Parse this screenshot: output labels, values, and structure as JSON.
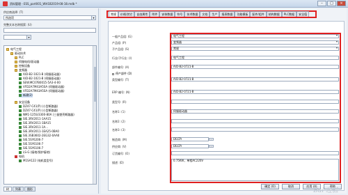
{
  "window": {
    "title": "资料管理 - ESS_part001_WH1B2019-08-18.mdb *"
  },
  "left": {
    "type_label": "供应商选择: (T)",
    "type_value": "所选项",
    "search_label": "完整文本名称搜索: (U)",
    "tree": [
      "电气工程",
      "驱动技术",
      "PLC",
      "伺服电机/驱动器",
      "控制设备",
      "变频器",
      "A/D-B2-1021-B (伺服驱动器)",
      "A/D-B2-1021-B (伺服驱动器)",
      "SEW.MC07B0015-5A3-4-00",
      "VFD2A7M43A5SA (伺服驱动器)",
      "VFD2A7M43A5SA (伺服驱动器)",
      "新建(2)",
      "安全设备",
      "DZ47-C41(P) (小型断路器)",
      "DZ47-C41(P) (小型断路器)",
      "NM1-125S/3300-80A (三极塑壳断路器)",
      "SIE.3RV2011-1AA15",
      "SIE.3RV2011-1BA15",
      "SIE.3RV2011-1A...",
      "SIE.3RV2011-1EA25-0BA0",
      "SIE.3SB3602-2EG32-0AA0",
      "SIE.5SY6206-7",
      "SIE.5SY6106-7",
      "SIE.5SY6106-7",
      "LS-G (接地/保护接地)",
      "电机",
      "M1SA122 (电机类型号)"
    ],
    "bottom_tabs": [
      "树",
      "列表",
      "图形"
    ]
  },
  "tabs": [
    "常规",
    "价格/其它",
    "自由属性",
    "附件",
    "安装数据",
    "符号",
    "技术数据",
    "文档",
    "生产",
    "报表数据",
    "功能模板",
    "配件/组件",
    "结构数据",
    "PLC数据",
    "安全值"
  ],
  "form": {
    "fields": [
      {
        "label": "一般产品组: (G)",
        "value": "电气工程"
      },
      {
        "label": "产品组: (P)",
        "value": "变频器"
      },
      {
        "label": "子产品组: (S)",
        "value": "常规"
      },
      {
        "label": "行业/子行业: (I)",
        "value": "电气工程"
      },
      {
        "label": "部件编号: (A)",
        "value": "A/D-B2-0721-B"
      },
      {
        "label": "类型编号: (T)",
        "value": "A/D-B2-0721-B"
      },
      {
        "label": "ERP 编号: (N)",
        "value": "A/D-B2-0721-B"
      },
      {
        "label": "类型号: (R)",
        "value": ""
      },
      {
        "label": "名称1: (1)",
        "value": "伺服驱动器"
      },
      {
        "label": "名称2: (2)",
        "value": ""
      },
      {
        "label": "名称3: (3)",
        "value": ""
      },
      {
        "label": "制造商: (M)",
        "value": "DELTA"
      },
      {
        "label": "供应商: (V)",
        "value": "DELTA"
      },
      {
        "label": "订货编号: (O)",
        "value": ""
      },
      {
        "label": "描述: (D)",
        "value": "0.75KW，单相AC220V"
      }
    ],
    "checkbox_label": "停产部件 (D)",
    "buttons": [
      "确定 (O)",
      "取消",
      "应用 (A)",
      "帮助"
    ]
  },
  "watermark": "Bai 经验"
}
